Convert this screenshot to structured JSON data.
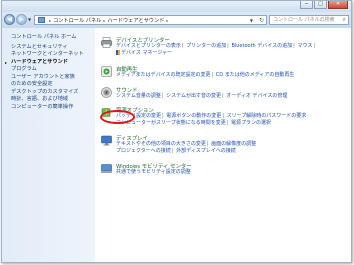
{
  "window": {
    "controls": [
      "─",
      "□",
      "✕"
    ]
  },
  "address": {
    "crumbs": [
      "コントロール パネル",
      "ハードウェアとサウンド"
    ],
    "search_placeholder": "コントロール パネルの検索"
  },
  "sidebar": {
    "items": [
      "コントロール パネル ホーム",
      "システムとセキュリティ",
      "ネットワークとインターネット",
      "ハードウェアとサウンド",
      "プログラム",
      "ユーザー アカウントと家族",
      "のための安全設定",
      "デスクトップのカスタマイズ",
      "時計、言語、および地域",
      "コンピューターの簡単操作"
    ]
  },
  "categories": {
    "devices": {
      "title": "デバイスとプリンター",
      "links_row1": [
        "デバイスとプリンターの表示",
        "プリンターの追加",
        "Bluetooth デバイスの追加",
        "マウス"
      ],
      "links_row2": [
        "デバイス マネージャー"
      ]
    },
    "autoplay": {
      "title": "自動再生",
      "links_row1": [
        "メディアまたはデバイスの既定設定の変更",
        "CD または他のメディアの自動再生"
      ]
    },
    "sound": {
      "title": "サウンド",
      "links_row1": [
        "システム音量の調整",
        "システムが出す音の変更",
        "オーディオ デバイスの管理"
      ]
    },
    "power": {
      "title": "電源オプション",
      "links_row1": [
        "バッテリ設定の変更",
        "電源ボタンの動作の変更",
        "スリープ解除時のパスワードの要求"
      ],
      "links_row2": [
        "コンピューターがスリープ状態になる時間を変更",
        "電源プランの選択"
      ]
    },
    "display": {
      "title": "ディスプレイ",
      "links_row1": [
        "テキストやその他の項目の大きさの変更",
        "画面の解像度の調整"
      ],
      "links_row2": [
        "プロジェクターへの接続",
        "外部ディスプレイへの接続"
      ]
    },
    "mobility": {
      "title": "Windows モビリティ センター",
      "links_row1": [
        "共通で使うモビリティ設定の調整"
      ]
    }
  },
  "highlight_color": "#e0141c"
}
